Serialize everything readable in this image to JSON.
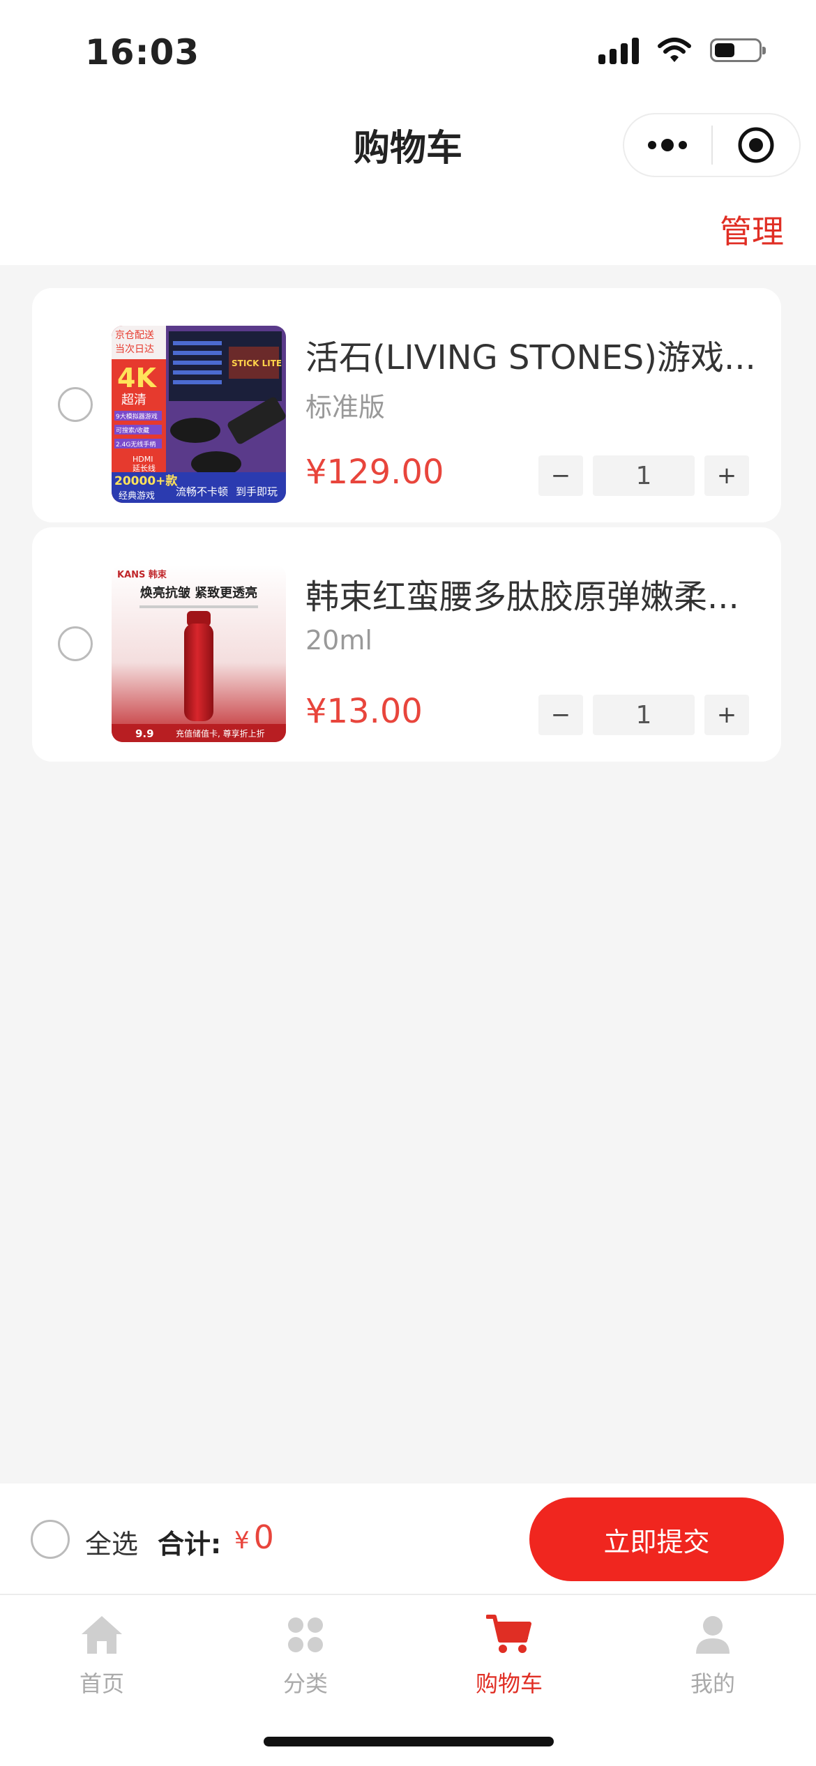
{
  "status_bar": {
    "time": "16:03"
  },
  "nav": {
    "title": "购物车",
    "manage_label": "管理"
  },
  "cart_items": [
    {
      "title": "活石(LIVING STONES)游戏...",
      "spec": "标准版",
      "price": "¥129.00",
      "quantity": "1",
      "minus": "−",
      "plus": "+"
    },
    {
      "title": "韩束红蛮腰多肽胶原弹嫩柔...",
      "spec": "20ml",
      "price": "¥13.00",
      "quantity": "1",
      "minus": "−",
      "plus": "+"
    }
  ],
  "product_images": {
    "item1": {
      "line1": "京仓配送",
      "line2": "当次日达",
      "badge": "4K",
      "badge_sub": "超清",
      "feat1": "9大模拟器游戏",
      "feat2": "可搜索/收藏",
      "feat3": "2.4G无线手柄",
      "feat4": "HDMI",
      "feat5": "延长线",
      "count": "20000+款",
      "count_sub": "经典游戏",
      "slogan": "流畅不卡顿",
      "slogan2": "到手即玩",
      "screen_title": "STICK LITE"
    },
    "item2": {
      "brand": "KANS 韩束",
      "headline": "焕亮抗皱 紧致更透亮",
      "price_tag": "9.9",
      "footer": "充值储值卡, 尊享折上折"
    }
  },
  "checkout": {
    "select_all_label": "全选",
    "total_label": "合计:",
    "currency": "¥",
    "total_value": "0",
    "submit_label": "立即提交"
  },
  "tabs": [
    {
      "label": "首页",
      "icon": "home-icon"
    },
    {
      "label": "分类",
      "icon": "category-icon"
    },
    {
      "label": "购物车",
      "icon": "cart-icon",
      "active": true
    },
    {
      "label": "我的",
      "icon": "profile-icon"
    }
  ],
  "colors": {
    "accent": "#e02e24",
    "price": "#e8453c",
    "submit_bg": "#f0261f"
  }
}
